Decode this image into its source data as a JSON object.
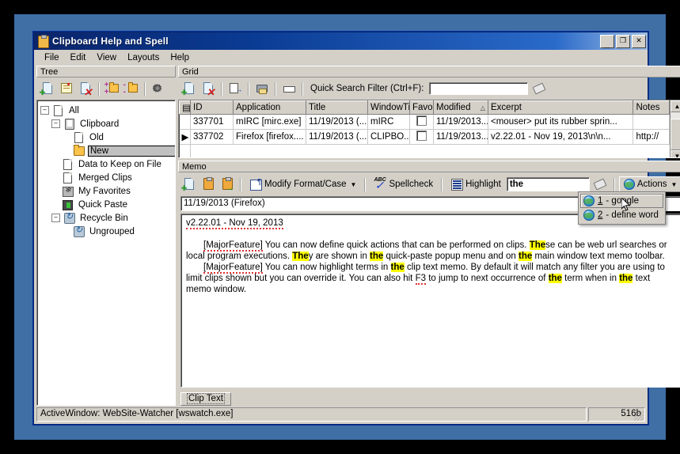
{
  "window": {
    "title": "Clipboard Help and Spell",
    "title_icon": "clipboard-icon",
    "minimize_label": "_",
    "maximize_label": "❐",
    "close_label": "✕"
  },
  "menubar": {
    "items": [
      {
        "label": "File"
      },
      {
        "label": "Edit"
      },
      {
        "label": "View"
      },
      {
        "label": "Layouts"
      },
      {
        "label": "Help"
      }
    ]
  },
  "tree_panel": {
    "header": "Tree",
    "toolbar": [
      {
        "name": "new-item-icon",
        "tip": "New"
      },
      {
        "name": "edit-item-icon",
        "tip": "Edit"
      },
      {
        "name": "delete-item-icon",
        "tip": "Delete"
      },
      {
        "name": "add-group-icon",
        "tip": "Add Group"
      },
      {
        "name": "remove-group-icon",
        "tip": "Remove Group"
      },
      {
        "name": "settings-gear-icon",
        "tip": "Options"
      }
    ],
    "nodes": [
      {
        "label": "All",
        "depth": 0,
        "icon": "document-icon",
        "expander": "-",
        "selected": false
      },
      {
        "label": "Clipboard",
        "depth": 1,
        "icon": "clipboard-icon",
        "expander": "-",
        "selected": false
      },
      {
        "label": "Old",
        "depth": 2,
        "icon": "document-icon",
        "expander": "",
        "selected": false
      },
      {
        "label": "New",
        "depth": 2,
        "icon": "folder-icon",
        "expander": "",
        "selected": true
      },
      {
        "label": "Data to Keep on File",
        "depth": 1,
        "icon": "document-icon",
        "expander": "",
        "selected": false
      },
      {
        "label": "Merged Clips",
        "depth": 1,
        "icon": "document-icon",
        "expander": "",
        "selected": false
      },
      {
        "label": "My Favorites",
        "depth": 1,
        "icon": "favorites-icon",
        "expander": "",
        "selected": false
      },
      {
        "label": "Quick Paste",
        "depth": 1,
        "icon": "quick-paste-icon",
        "expander": "",
        "selected": false
      },
      {
        "label": "Recycle Bin",
        "depth": 1,
        "icon": "recycle-bin-icon",
        "expander": "-",
        "selected": false
      },
      {
        "label": "Ungrouped",
        "depth": 2,
        "icon": "recycle-bin-icon",
        "expander": "",
        "selected": false
      }
    ]
  },
  "grid_panel": {
    "header": "Grid",
    "toolbar": [
      {
        "name": "new-clip-icon"
      },
      {
        "name": "delete-clip-icon"
      },
      {
        "name": "copy-to-icon"
      },
      {
        "name": "print-icon"
      },
      {
        "name": "preview-icon"
      }
    ],
    "search_label": "Quick Search Filter (Ctrl+F):",
    "search_value": "",
    "search_placeholder": "",
    "clear_icon": "eraser-icon",
    "columns": [
      "ID",
      "Application",
      "Title",
      "WindowTit",
      "Favo",
      "Modified",
      "Excerpt",
      "Notes"
    ],
    "sort_column": "Modified",
    "sort_direction": "ascending",
    "rows": [
      {
        "selected": false,
        "id": "337701",
        "application": "mIRC [mirc.exe]",
        "title": "11/19/2013 (...",
        "window_title": "mIRC",
        "favorite": false,
        "modified": "11/19/2013...",
        "excerpt": "<mouser> put its rubber sprin...",
        "notes": ""
      },
      {
        "selected": true,
        "id": "337702",
        "application": "Firefox [firefox....",
        "title": "11/19/2013 (...",
        "window_title": "CLIPBO...",
        "favorite": false,
        "modified": "11/19/2013...",
        "excerpt": "v2.22.01 - Nov 19, 2013\\n\\n...",
        "notes": "http://"
      }
    ],
    "scroll_up": "▲",
    "scroll_down": "▼"
  },
  "memo_panel": {
    "header": "Memo",
    "toolbar": [
      {
        "name": "new-memo-icon"
      },
      {
        "name": "paste-clip-icon"
      },
      {
        "name": "export-clip-icon"
      }
    ],
    "modify_format_label": "Modify Format/Case",
    "spellcheck_label": "Spellcheck",
    "highlight_label": "Highlight",
    "highlight_value": "the",
    "erase_icon": "eraser-icon",
    "actions_label": "Actions",
    "date_line": "11/19/2013 (Firefox)",
    "content": {
      "version_line": "v2.22.01 - Nov 19, 2013",
      "paragraphs": [
        {
          "segments": [
            {
              "text": "[MajorFeature]",
              "style": "squiggle"
            },
            {
              "text": " You can now define quick actions that can be performed on clips.  ",
              "style": "plain"
            },
            {
              "text": "The",
              "style": "highlight"
            },
            {
              "text": "se can be web url searches or local program executions.  ",
              "style": "plain"
            },
            {
              "text": "The",
              "style": "highlight"
            },
            {
              "text": "y are shown in ",
              "style": "plain"
            },
            {
              "text": "the",
              "style": "highlight"
            },
            {
              "text": " quick-paste popup menu and on ",
              "style": "plain"
            },
            {
              "text": "the",
              "style": "highlight"
            },
            {
              "text": " main window text memo toolbar.",
              "style": "plain"
            }
          ]
        },
        {
          "segments": [
            {
              "text": "[MajorFeature]",
              "style": "squiggle"
            },
            {
              "text": " You can now highlight terms in ",
              "style": "plain"
            },
            {
              "text": "the",
              "style": "highlight"
            },
            {
              "text": " clip text memo.  By default it will match any filter you are using to limit clips shown but you can override it.  You can also hit ",
              "style": "plain"
            },
            {
              "text": "F3",
              "style": "squiggle"
            },
            {
              "text": " to jump to next occurrence of ",
              "style": "plain"
            },
            {
              "text": "the",
              "style": "highlight"
            },
            {
              "text": " term when in ",
              "style": "plain"
            },
            {
              "text": "the",
              "style": "highlight"
            },
            {
              "text": " text memo window.",
              "style": "plain"
            }
          ]
        }
      ]
    },
    "tab_label": "Clip Text"
  },
  "actions_menu": {
    "open": true,
    "items": [
      {
        "number": "1",
        "label": "- google",
        "hovered": true,
        "icon": "globe-icon"
      },
      {
        "number": "2",
        "label": "- define word",
        "hovered": false,
        "icon": "globe-icon"
      }
    ]
  },
  "statusbar": {
    "active_window": "ActiveWindow: WebSite-Watcher [wswatch.exe]",
    "size": "516b"
  },
  "colors": {
    "title_start": "#0a246a",
    "title_end": "#9cbce4",
    "face": "#d4d0c8",
    "highlight_yellow": "#ffff00",
    "desktop": "#3f6fa5"
  }
}
